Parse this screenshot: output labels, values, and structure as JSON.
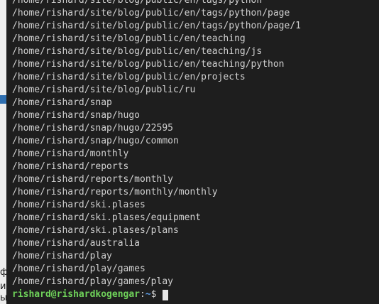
{
  "background_window": {
    "glyphs": [
      "ф",
      "и",
      "ы"
    ]
  },
  "terminal": {
    "output_lines": [
      "/home/rishard/site/blog/public/en/tags/python",
      "/home/rishard/site/blog/public/en/tags/python/page",
      "/home/rishard/site/blog/public/en/tags/python/page/1",
      "/home/rishard/site/blog/public/en/teaching",
      "/home/rishard/site/blog/public/en/teaching/js",
      "/home/rishard/site/blog/public/en/teaching/python",
      "/home/rishard/site/blog/public/en/projects",
      "/home/rishard/site/blog/public/ru",
      "/home/rishard/snap",
      "/home/rishard/snap/hugo",
      "/home/rishard/snap/hugo/22595",
      "/home/rishard/snap/hugo/common",
      "/home/rishard/monthly",
      "/home/rishard/reports",
      "/home/rishard/reports/monthly",
      "/home/rishard/reports/monthly/monthly",
      "/home/rishard/ski.plases",
      "/home/rishard/ski.plases/equipment",
      "/home/rishard/ski.plases/plans",
      "/home/rishard/australia",
      "/home/rishard/play",
      "/home/rishard/play/games",
      "/home/rishard/play/games/play"
    ],
    "prompt": {
      "user_host": "rishard@rishardkogengar",
      "separator": ":",
      "path": "~",
      "symbol": "$ "
    }
  },
  "colors": {
    "terminal_background": "#1e1e1e",
    "text": "#d0d0d0",
    "prompt_user": "#6fd25a",
    "prompt_path": "#5e9de6",
    "cursor": "#e6e6e6",
    "behind_accent": "#2f6fb0"
  }
}
